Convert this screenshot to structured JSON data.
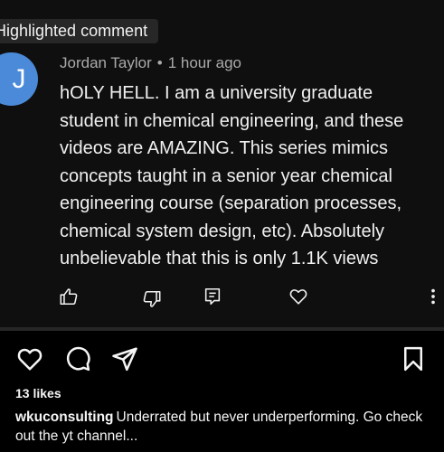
{
  "youtube_comment": {
    "badge": "Highlighted comment",
    "avatar_letter": "J",
    "author": "Jordan Taylor",
    "separator": "•",
    "time": "1 hour ago",
    "text": "hOLY HELL. I am a university graduate student in chemical engineering, and these videos are AMAZING. This series mimics concepts taught in a senior year chemical engineering course (separation processes, chemical system design, etc). Absolutely unbelievable that this is only 1.1K views",
    "actions": [
      "thumbs-up-icon",
      "thumbs-down-icon",
      "reply-icon",
      "heart-icon",
      "more-vertical-icon"
    ],
    "avatar_color": "#4a8ad8"
  },
  "instagram_post": {
    "actions": [
      "heart-icon",
      "comment-icon",
      "share-icon",
      "bookmark-icon"
    ],
    "likes": "13 likes",
    "username": "wkuconsulting",
    "caption": "Underrated but never underperforming. Go check out the yt channel..."
  }
}
